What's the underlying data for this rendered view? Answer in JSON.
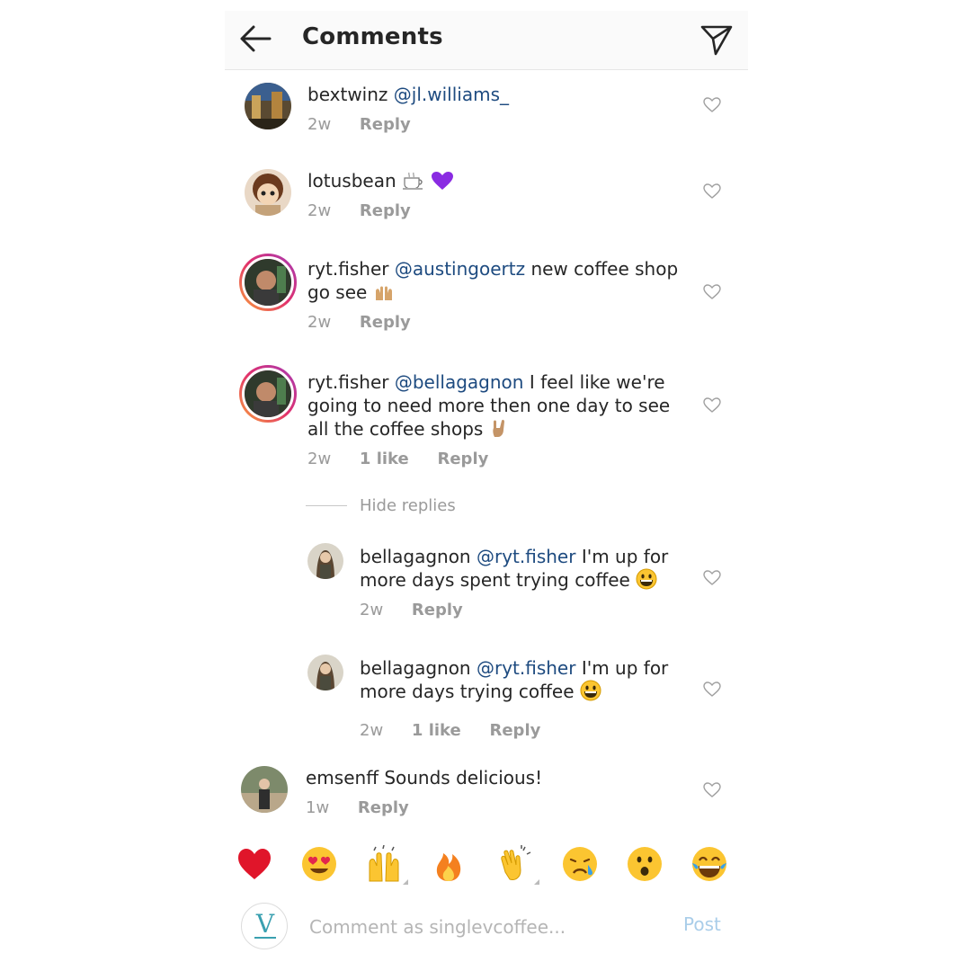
{
  "header": {
    "title": "Comments"
  },
  "comments": [
    {
      "username": "bextwinz",
      "mention": "@jl.williams_",
      "text": "",
      "time": "2w",
      "likes": "",
      "reply": "Reply"
    },
    {
      "username": "lotusbean",
      "mention": "",
      "text": "",
      "time": "2w",
      "likes": "",
      "reply": "Reply",
      "emojis": [
        "coffee",
        "purple-heart"
      ]
    },
    {
      "username": "ryt.fisher",
      "mention": "@austingoertz",
      "text": "new coffee shop go see",
      "time": "2w",
      "likes": "",
      "reply": "Reply",
      "emojis": [
        "raising-hands"
      ]
    },
    {
      "username": "ryt.fisher",
      "mention": "@bellagagnon",
      "text": "I feel like we're going to need more then one day to see all the coffee shops",
      "time": "2w",
      "likes": "1 like",
      "reply": "Reply",
      "emojis": [
        "horns"
      ]
    },
    {
      "username": "bellagagnon",
      "mention": "@ryt.fisher",
      "text": "I'm up for more days spent trying coffee",
      "time": "2w",
      "likes": "",
      "reply": "Reply",
      "emojis": [
        "grinning"
      ]
    },
    {
      "username": "bellagagnon",
      "mention": "@ryt.fisher",
      "text": "I'm up for more days trying coffee",
      "time": "2w",
      "likes": "1 like",
      "reply": "Reply",
      "emojis": [
        "grinning"
      ]
    },
    {
      "username": "emsenff",
      "mention": "",
      "text": "Sounds delicious!",
      "time": "1w",
      "likes": "",
      "reply": "Reply"
    }
  ],
  "hide_replies": "Hide replies",
  "reactions": [
    "red-heart",
    "heart-eyes",
    "raising-hands",
    "fire",
    "clapping-hands",
    "crying-face",
    "surprised-face",
    "tears-of-joy"
  ],
  "composer": {
    "placeholder": "Comment as singlevcoffee...",
    "post_label": "Post",
    "avatar_letter": "V"
  },
  "colors": {
    "mention": "#1e4b80",
    "post": "#a9cde9",
    "muted": "#9a9a9a"
  }
}
